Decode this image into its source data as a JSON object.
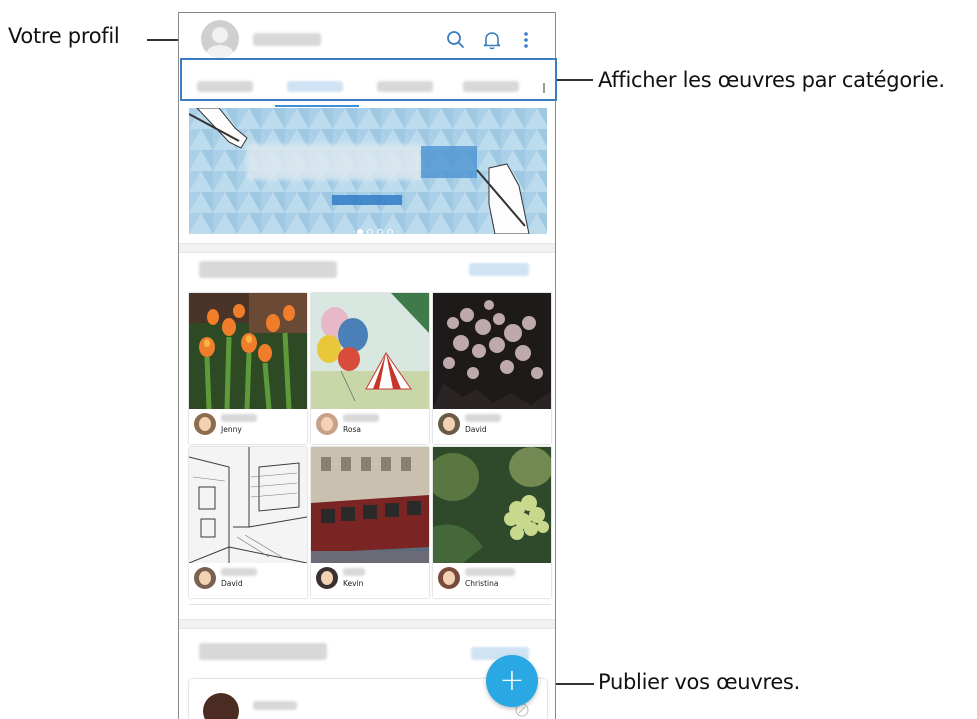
{
  "callouts": {
    "profile": "Votre profil",
    "categories": "Afficher les œuvres par catégorie.",
    "publish": "Publier vos œuvres."
  },
  "header": {
    "icons": [
      "search-icon",
      "bell-icon",
      "more-vertical-icon"
    ]
  },
  "feed": {
    "artworks": [
      {
        "author": "Jenny",
        "art": "tulips"
      },
      {
        "author": "Rosa",
        "art": "balloons-circus-tent"
      },
      {
        "author": "David",
        "art": "blossom-night"
      },
      {
        "author": "David",
        "art": "street-sketch"
      },
      {
        "author": "Kevin",
        "art": "red-tram"
      },
      {
        "author": "Christina",
        "art": "green-flowers"
      }
    ]
  },
  "fab": {
    "symbol": "+"
  },
  "colors": {
    "accent": "#29a8e3",
    "highlight": "#3a7dc0",
    "tab_underline": "#3a8fd8"
  }
}
